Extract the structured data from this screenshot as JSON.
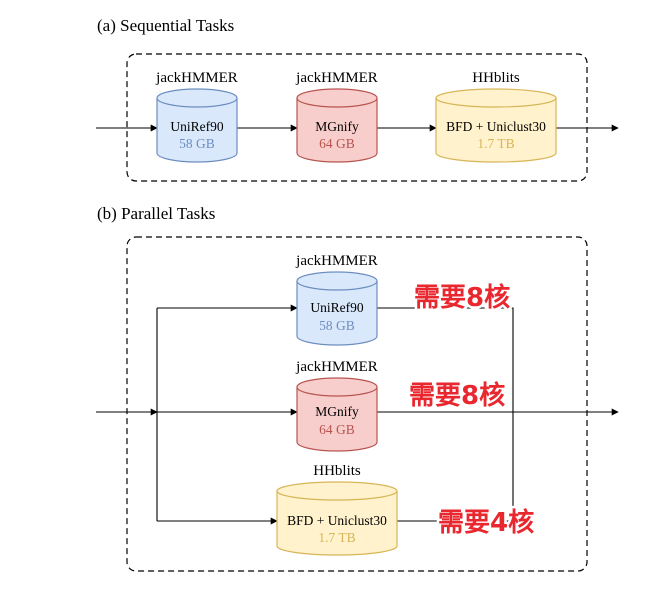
{
  "sections": {
    "sequential_title": "(a) Sequential Tasks",
    "parallel_title": "(b) Parallel Tasks"
  },
  "sequential": {
    "uniref": {
      "tool": "jackHMMER",
      "name": "UniRef90",
      "size": "58 GB"
    },
    "mgnify": {
      "tool": "jackHMMER",
      "name": "MGnify",
      "size": "64 GB"
    },
    "bfd": {
      "tool": "HHblits",
      "name": "BFD + Uniclust30",
      "size": "1.7 TB"
    }
  },
  "parallel": {
    "uniref": {
      "tool": "jackHMMER",
      "name": "UniRef90",
      "size": "58 GB",
      "cores": "需要8核"
    },
    "mgnify": {
      "tool": "jackHMMER",
      "name": "MGnify",
      "size": "64 GB",
      "cores": "需要8核"
    },
    "bfd": {
      "tool": "HHblits",
      "name": "BFD + Uniclust30",
      "size": "1.7 TB",
      "cores": "需要4核"
    }
  },
  "colors": {
    "blue_fill": "#dae8fc",
    "blue_stroke": "#6c8ebf",
    "red_fill": "#f8cecc",
    "red_stroke": "#b85450",
    "yellow_fill": "#fff2cc",
    "yellow_stroke": "#d6b656",
    "cores_text": "#e8272f"
  }
}
